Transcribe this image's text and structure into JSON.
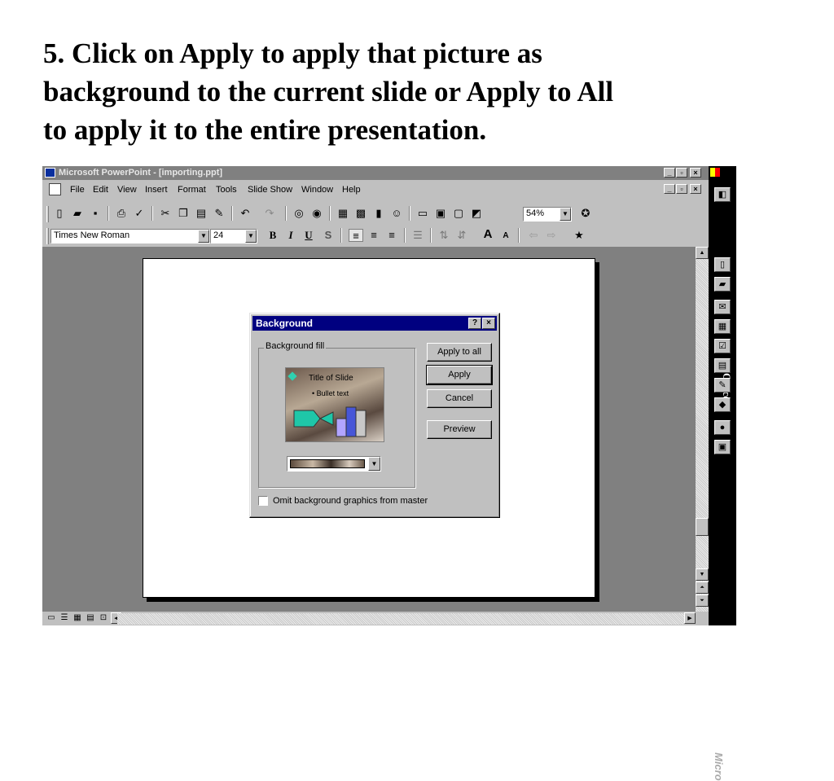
{
  "caption": {
    "line1": "5.  Click on Apply to apply that picture as",
    "line2": "background to the current slide or Apply to All",
    "line3": "to apply it to the entire presentation."
  },
  "window": {
    "title": "Microsoft PowerPoint - [importing.ppt]",
    "controls": {
      "minimize": "_",
      "restore": "▫",
      "close": "×"
    }
  },
  "menubar": {
    "items": [
      "File",
      "Edit",
      "View",
      "Insert",
      "Format",
      "Tools",
      "Slide Show",
      "Window",
      "Help"
    ]
  },
  "toolbar": {
    "zoom": "54%"
  },
  "formatting": {
    "font": "Times New Roman",
    "size": "24",
    "bold": "B",
    "italic": "I",
    "underline": "U",
    "shadow": "S"
  },
  "dialog": {
    "title": "Background",
    "help": "?",
    "close": "×",
    "group_label": "Background fill",
    "preview_title": "Title of Slide",
    "preview_bullet": "• Bullet text",
    "buttons": {
      "apply_all": "Apply to all",
      "apply": "Apply",
      "cancel": "Cancel",
      "preview": "Preview"
    },
    "checkbox_label": "Omit background graphics from master"
  },
  "office_bar": {
    "label": "Office",
    "bottom_label": "Micro"
  }
}
